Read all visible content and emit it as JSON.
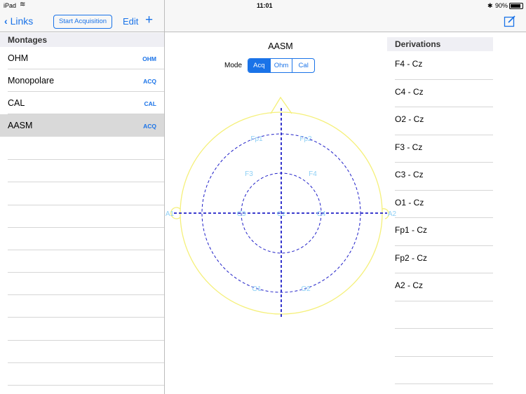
{
  "status": {
    "device": "iPad",
    "time": "11:01",
    "battery": "90%"
  },
  "nav": {
    "back": "Links",
    "start": "Start Acquisition",
    "edit": "Edit",
    "add": "+"
  },
  "montages": {
    "header": "Montages",
    "items": [
      {
        "name": "OHM",
        "tag": "OHM"
      },
      {
        "name": "Monopolare",
        "tag": "ACQ"
      },
      {
        "name": "CAL",
        "tag": "CAL"
      },
      {
        "name": "AASM",
        "tag": "ACQ",
        "selected": true
      }
    ]
  },
  "main": {
    "title": "AASM",
    "mode_label": "Mode",
    "modes": [
      "Acq",
      "Ohm",
      "Cal"
    ],
    "selected_mode": "Acq",
    "electrodes": {
      "fp1": "Fp1",
      "fp2": "Fp2",
      "f3": "F3",
      "f4": "F4",
      "a1": "A1",
      "a2": "A2",
      "c3": "C3",
      "cz": "Cz",
      "c4": "C4",
      "o1": "O1",
      "o2": "O2"
    }
  },
  "derivations": {
    "header": "Derivations",
    "items": [
      "F4 - Cz",
      "C4 - Cz",
      "O2 - Cz",
      "F3 - Cz",
      "C3 - Cz",
      "O1 - Cz",
      "Fp1 - Cz",
      "Fp2 - Cz",
      "A2 - Cz"
    ]
  },
  "colors": {
    "accent": "#1a73e8",
    "head": "#f5f07a",
    "lines": "#2020c8",
    "labels": "#8fd0f5"
  }
}
